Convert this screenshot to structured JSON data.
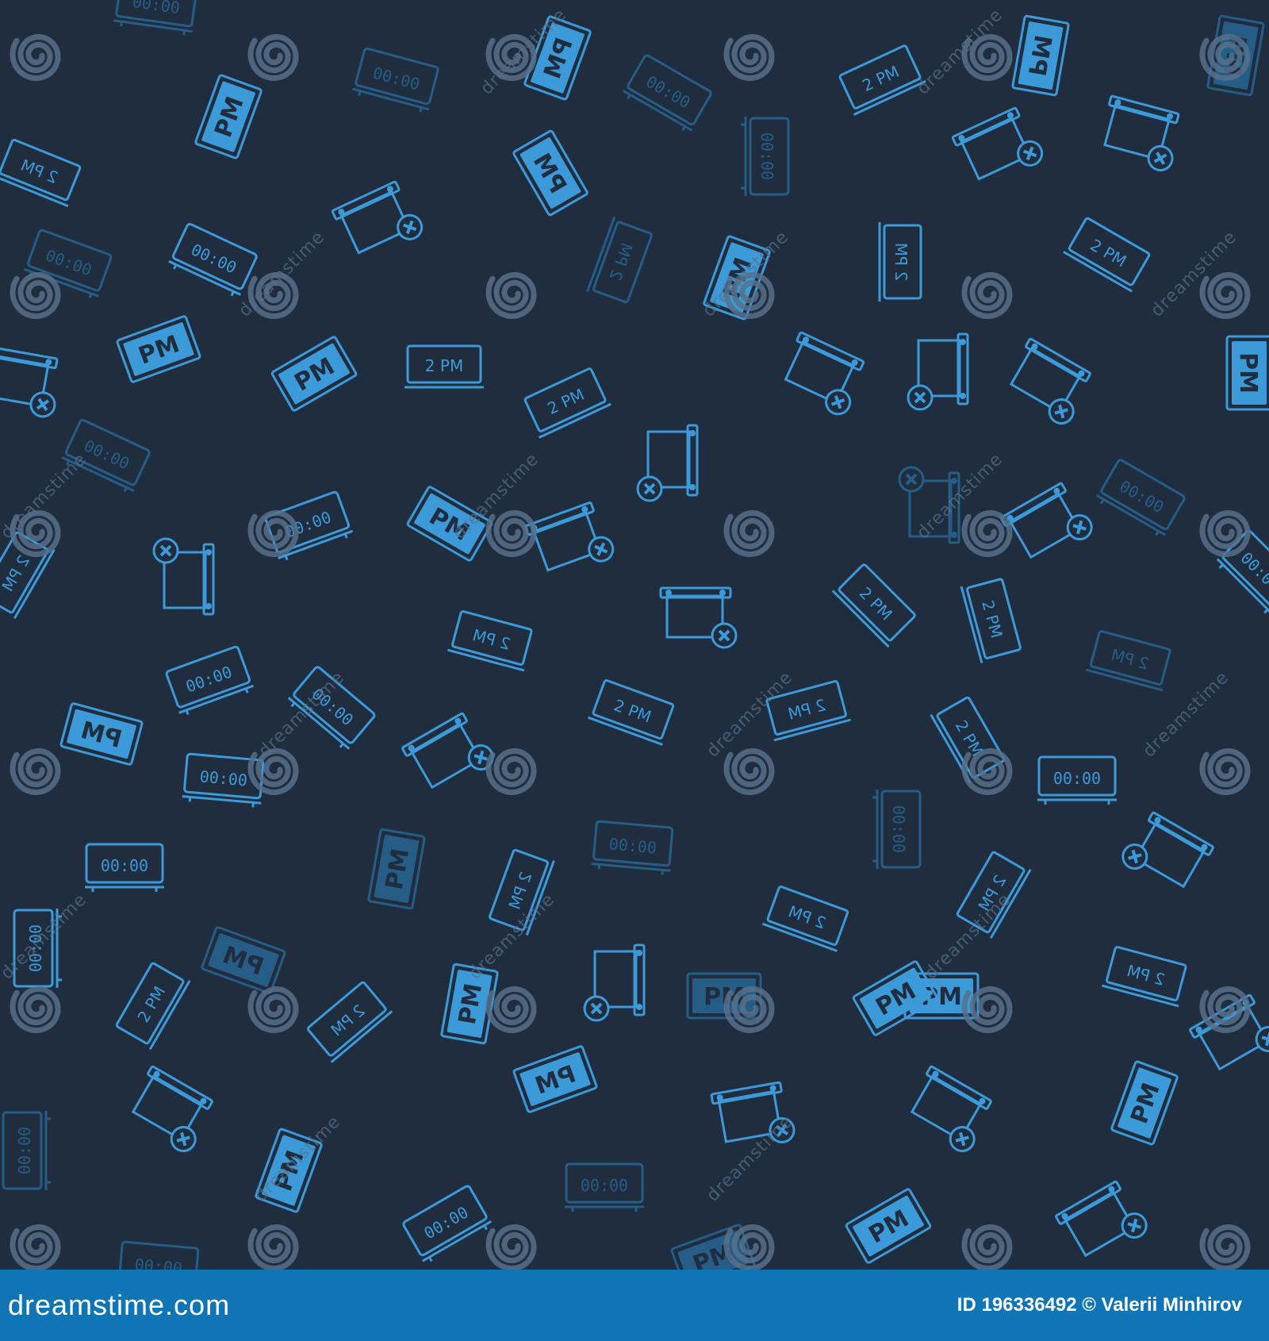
{
  "pattern": {
    "background_color": "#1f2d3f",
    "icon_color": "#3d9ad8",
    "icon_color_dim": "#2a70a3",
    "watermark_color": "#58708a",
    "icon_names": [
      "digital-clock-icon",
      "pm-label-icon",
      "2pm-label-icon",
      "calendar-delete-icon"
    ],
    "clock_text": "00:00",
    "pm_text": "PM",
    "two_pm_text": "2 PM",
    "watermark_text": "dreamstime",
    "watermark_logo": "spiral-logo"
  },
  "footer": {
    "brand": "dreamstime.com",
    "credit": "ID 196336492 © Valerii Minhirov",
    "background_color": "#0f75b5"
  }
}
